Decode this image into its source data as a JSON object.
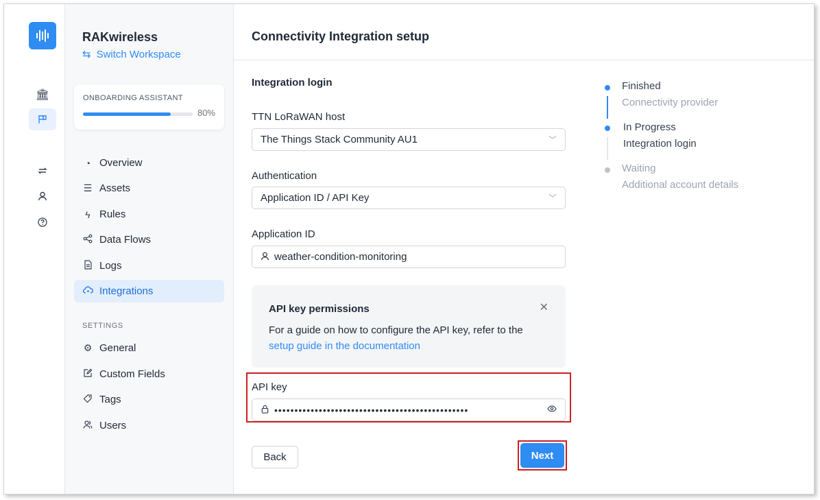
{
  "workspace": {
    "name": "RAKwireless",
    "switch_label": "Switch Workspace"
  },
  "onboarding": {
    "label": "ONBOARDING ASSISTANT",
    "progress_text": "80%",
    "progress": 0.8
  },
  "nav": {
    "overview": "Overview",
    "assets": "Assets",
    "rules": "Rules",
    "data_flows": "Data Flows",
    "logs": "Logs",
    "integrations": "Integrations",
    "settings_label": "SETTINGS",
    "general": "General",
    "custom_fields": "Custom Fields",
    "tags": "Tags",
    "users": "Users"
  },
  "page": {
    "title": "Connectivity Integration setup"
  },
  "form": {
    "section_title": "Integration login",
    "host_label": "TTN LoRaWAN host",
    "host_value": "The Things Stack Community AU1",
    "auth_label": "Authentication",
    "auth_value": "Application ID / API Key",
    "app_id_label": "Application ID",
    "app_id_value": "weather-condition-monitoring",
    "api_key_label": "API key",
    "api_key_value": "••••••••••••••••••••••••••••••••••••••••••••••••",
    "back_label": "Back",
    "next_label": "Next"
  },
  "notice": {
    "title": "API key permissions",
    "text": "For a guide on how to configure the API key, refer to the",
    "link": "setup guide in the documentation"
  },
  "steps": [
    {
      "status": "Finished",
      "name": "Connectivity provider"
    },
    {
      "status": "In Progress",
      "name": "Integration login"
    },
    {
      "status": "Waiting",
      "name": "Additional account details"
    }
  ],
  "colors": {
    "accent": "#2f8cf3",
    "highlight": "#cc1f1f",
    "muted": "#9ca3af"
  }
}
